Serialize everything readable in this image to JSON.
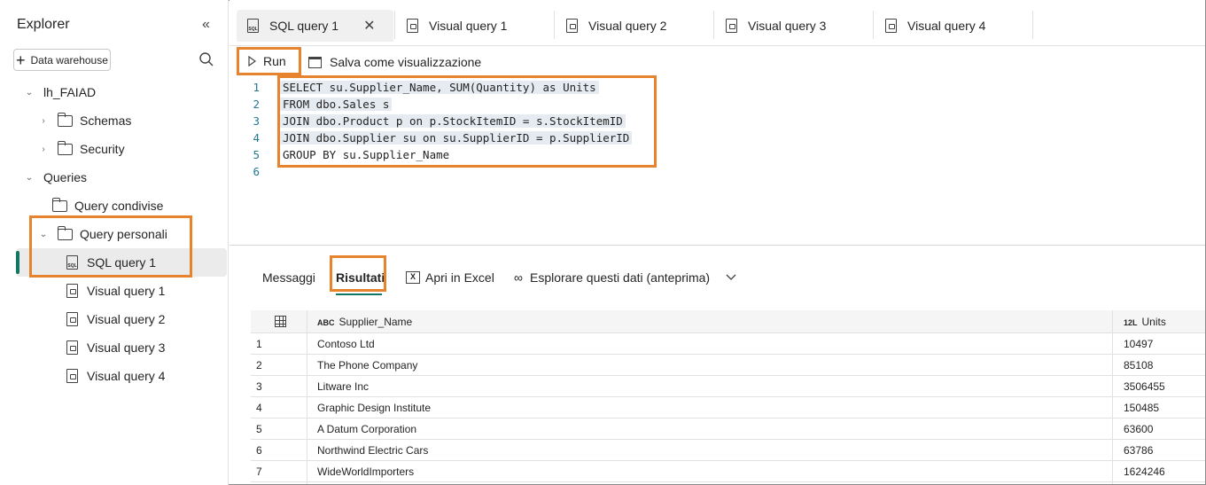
{
  "explorer": {
    "title": "Explorer",
    "data_warehouse_button": "Data warehouse",
    "warehouse_name": "lh_FAIAD",
    "schemas": "Schemas",
    "security": "Security",
    "queries": "Queries",
    "shared_queries": "Query condivise",
    "personal_queries": "Query personali",
    "items": [
      "SQL query 1",
      "Visual query 1",
      "Visual query 2",
      "Visual query 3",
      "Visual query 4"
    ]
  },
  "tabs": [
    "SQL query 1",
    "Visual query 1",
    "Visual query 2",
    "Visual query 3",
    "Visual query 4"
  ],
  "toolbar": {
    "run": "Run",
    "save_as_view": "Salva come visualizzazione"
  },
  "editor": {
    "line_numbers": [
      "1",
      "2",
      "3",
      "4",
      "5",
      "6"
    ],
    "lines": [
      "SELECT su.Supplier_Name, SUM(Quantity) as Units",
      "FROM dbo.Sales s",
      "JOIN dbo.Product p on p.StockItemID = s.StockItemID",
      "JOIN dbo.Supplier su on su.SupplierID = p.SupplierID",
      "GROUP BY su.Supplier_Name",
      ""
    ]
  },
  "results": {
    "tab_messages": "Messaggi",
    "tab_results": "Risultati",
    "open_excel": "Apri in Excel",
    "explore": "Esplorare questi dati (anteprima)",
    "columns": [
      {
        "type": "ABC",
        "name": "Supplier_Name"
      },
      {
        "type": "12L",
        "name": "Units"
      }
    ],
    "rows": [
      {
        "n": "1",
        "name": "Contoso Ltd",
        "units": "10497"
      },
      {
        "n": "2",
        "name": "The Phone Company",
        "units": "85108"
      },
      {
        "n": "3",
        "name": "Litware Inc",
        "units": "3506455"
      },
      {
        "n": "4",
        "name": "Graphic Design Institute",
        "units": "150485"
      },
      {
        "n": "5",
        "name": "A Datum Corporation",
        "units": "63600"
      },
      {
        "n": "6",
        "name": "Northwind Electric Cars",
        "units": "63786"
      },
      {
        "n": "7",
        "name": "WideWorldImporters",
        "units": "1624246"
      }
    ]
  },
  "colors": {
    "highlight": "#e7832c",
    "accent": "#117865"
  }
}
